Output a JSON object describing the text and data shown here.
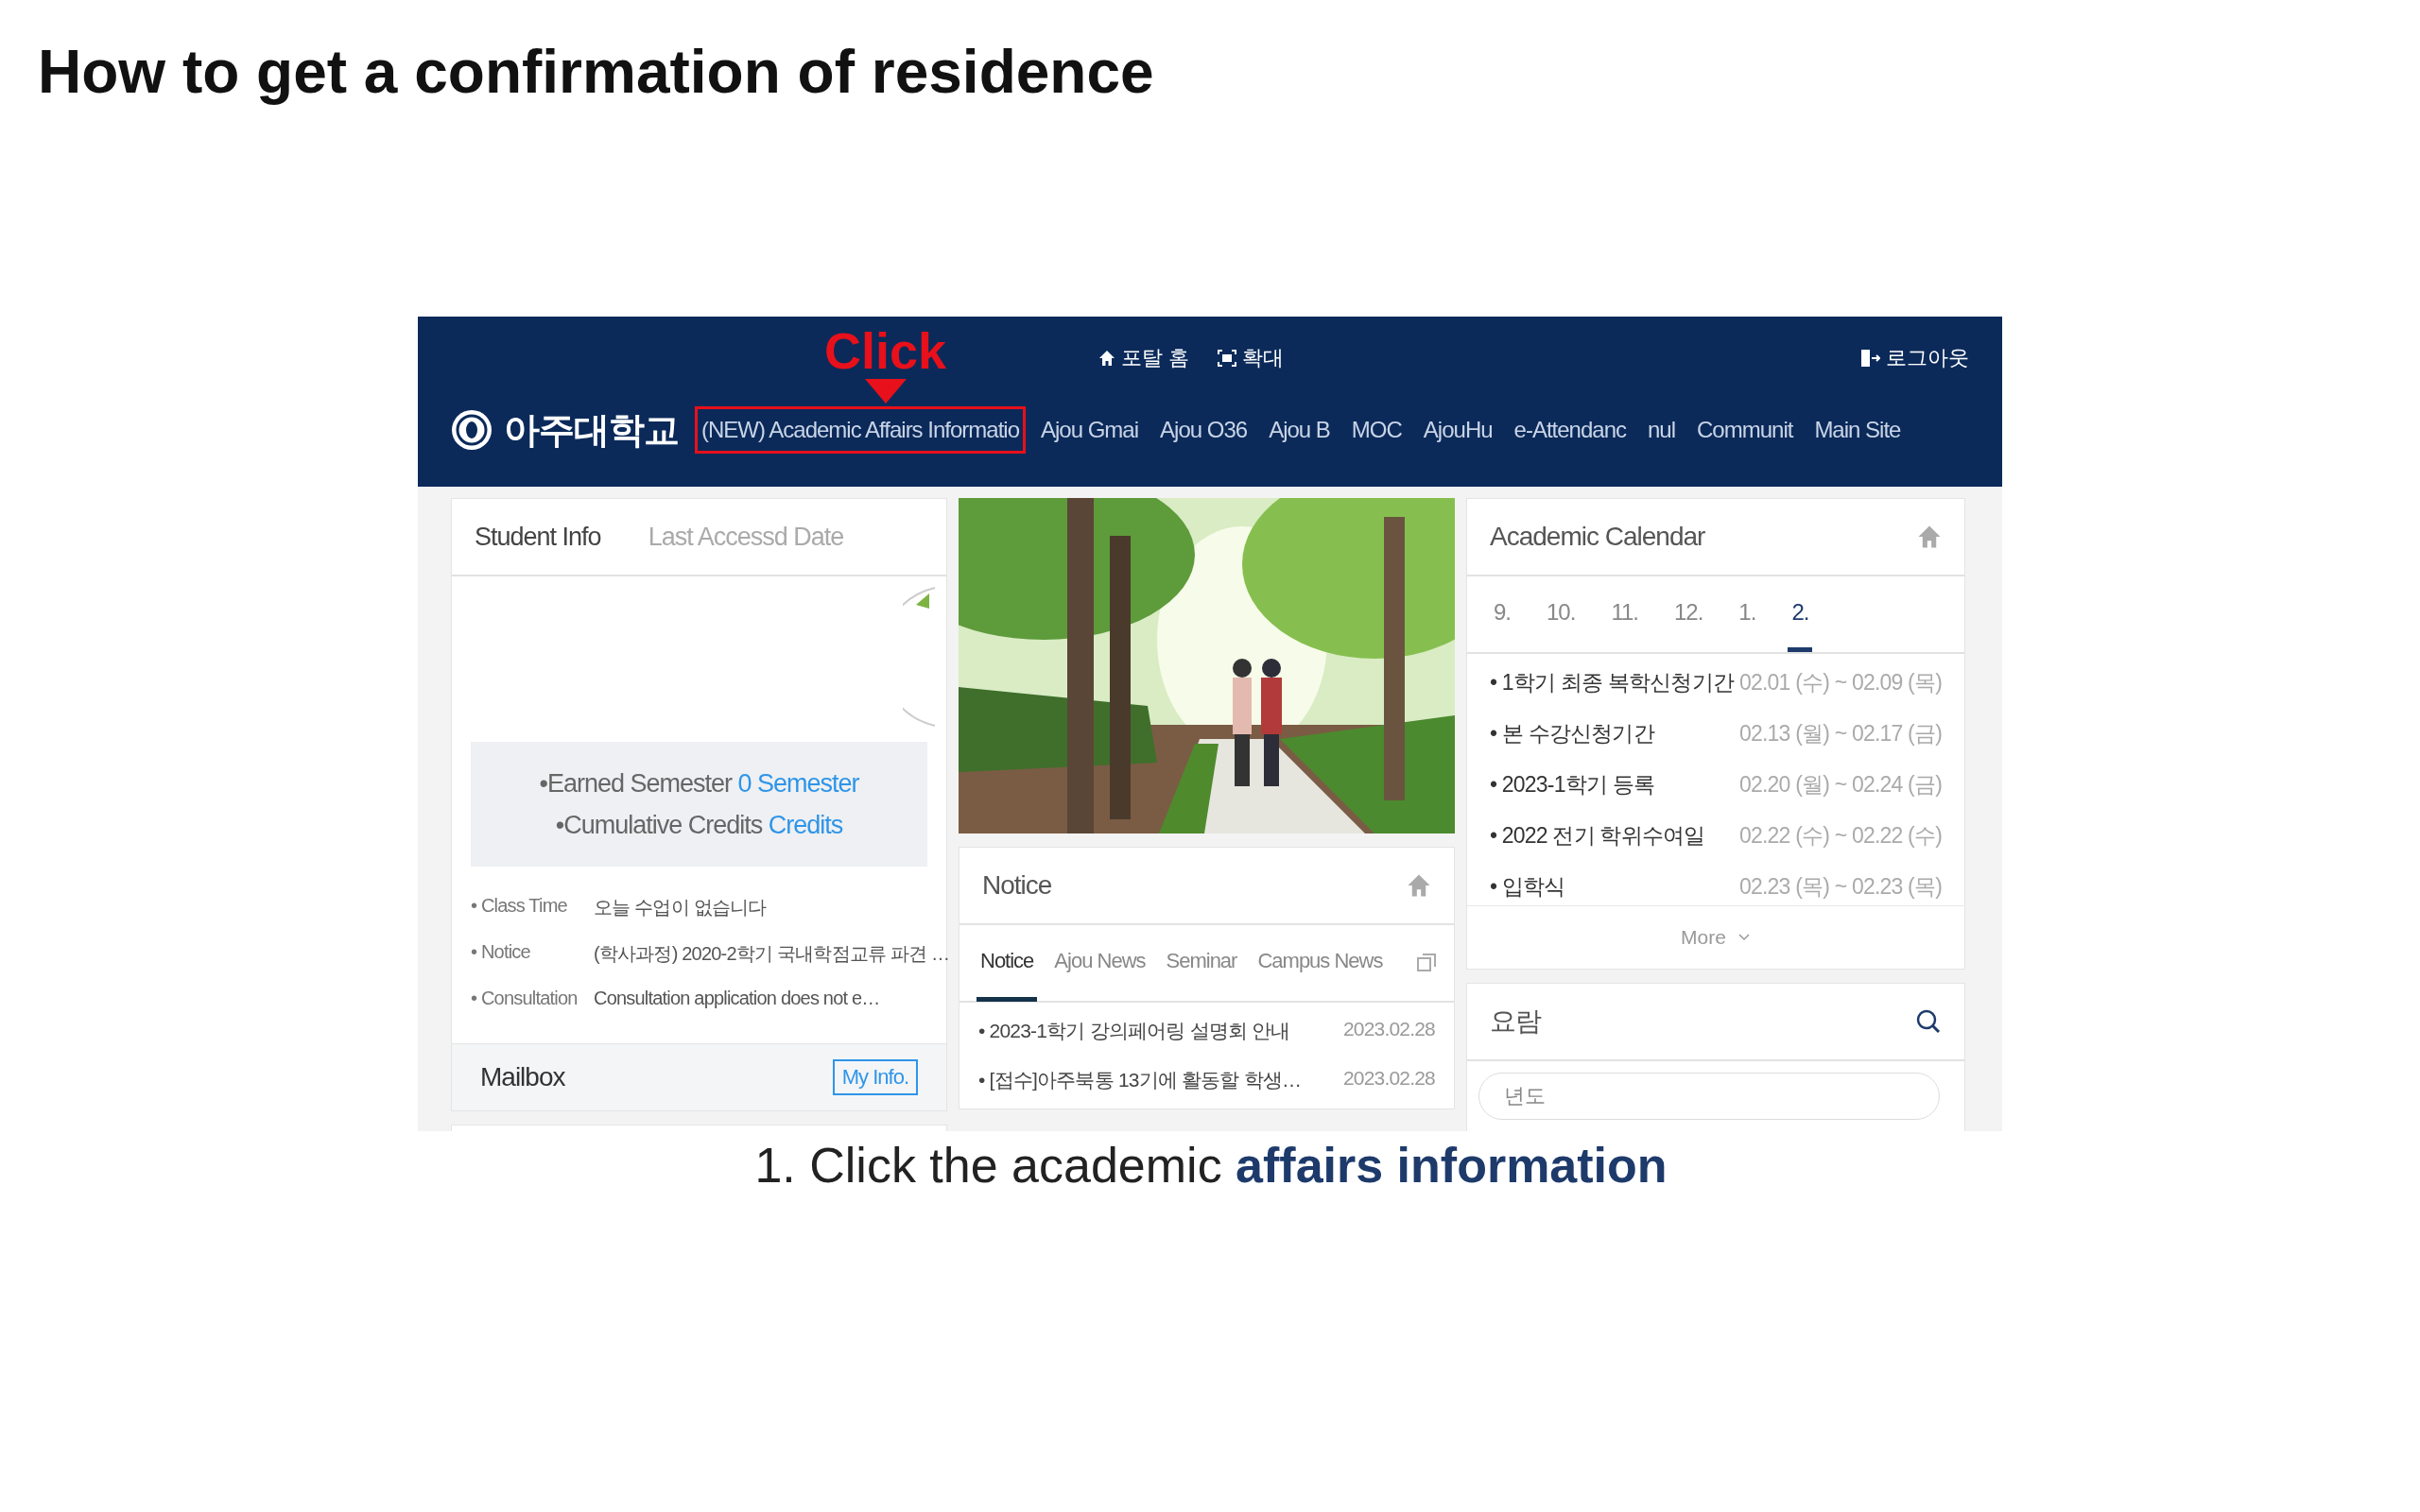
{
  "title": "How to get a confirmation of residence",
  "screenshot": {
    "annotation": {
      "label": "Click"
    },
    "top_links": [
      {
        "label": "포탈 홈",
        "kind": "home"
      },
      {
        "label": "확대",
        "kind": "zoom"
      },
      {
        "label": "로그아웃",
        "kind": "logout"
      }
    ],
    "logo": "아주대학교",
    "nav": [
      {
        "label": "(NEW) Academic Affairs Informatio",
        "highlighted": true
      },
      {
        "label": "Ajou Gmai",
        "highlighted": false
      },
      {
        "label": "Ajou O36",
        "highlighted": false
      },
      {
        "label": "Ajou B",
        "highlighted": false
      },
      {
        "label": "MOC",
        "highlighted": false
      },
      {
        "label": "AjouHu",
        "highlighted": false
      },
      {
        "label": "e-Attendanc",
        "highlighted": false
      },
      {
        "label": "nul",
        "highlighted": false
      },
      {
        "label": "Communit",
        "highlighted": false
      },
      {
        "label": "Main Site",
        "highlighted": false
      }
    ],
    "student_info": {
      "tabs": [
        {
          "label": "Student Info",
          "selected": true
        },
        {
          "label": "Last Accessd Date",
          "selected": false
        }
      ],
      "summary": [
        {
          "label": "•Earned Semester",
          "value": "0 Semester"
        },
        {
          "label": "•Cumulative Credits",
          "value": "Credits"
        }
      ],
      "details": [
        {
          "label": "• Class Time",
          "value": "오늘 수업이 없습니다"
        },
        {
          "label": "• Notice",
          "value": "(학사과정) 2020-2학기 국내학점교류 파견 …"
        },
        {
          "label": "• Consultation",
          "value": "Consultation application does not e…"
        }
      ],
      "mailbox": "Mailbox",
      "my_info": "My Info."
    },
    "notice": {
      "title": "Notice",
      "tabs": [
        {
          "label": "Notice",
          "selected": true
        },
        {
          "label": "Ajou News",
          "selected": false
        },
        {
          "label": "Seminar",
          "selected": false
        },
        {
          "label": "Campus News",
          "selected": false
        }
      ],
      "items": [
        {
          "title": "• 2023-1학기 강의페어링 설명회 안내",
          "date": "2023.02.28"
        },
        {
          "title": "• [접수]아주북통 13기에 활동할 학생…",
          "date": "2023.02.28"
        }
      ]
    },
    "calendar": {
      "title": "Academic Calendar",
      "months": [
        {
          "label": "9.",
          "selected": false
        },
        {
          "label": "10.",
          "selected": false
        },
        {
          "label": "11.",
          "selected": false
        },
        {
          "label": "12.",
          "selected": false
        },
        {
          "label": "1.",
          "selected": false
        },
        {
          "label": "2.",
          "selected": true
        }
      ],
      "events": [
        {
          "title": "• 1학기 최종 복학신청기간",
          "dates": "02.01 (수) ~ 02.09 (목)"
        },
        {
          "title": "• 본 수강신청기간",
          "dates": "02.13 (월) ~ 02.17 (금)"
        },
        {
          "title": "• 2023-1학기 등록",
          "dates": "02.20 (월) ~ 02.24 (금)"
        },
        {
          "title": "• 2022 전기 학위수여일",
          "dates": "02.22 (수) ~ 02.22 (수)"
        },
        {
          "title": "• 입학식",
          "dates": "02.23 (목) ~ 02.23 (목)"
        }
      ],
      "more": "More"
    },
    "handbook": {
      "title": "요람",
      "placeholder": "년도"
    }
  },
  "caption": "1. Click the academic **affairs information**"
}
